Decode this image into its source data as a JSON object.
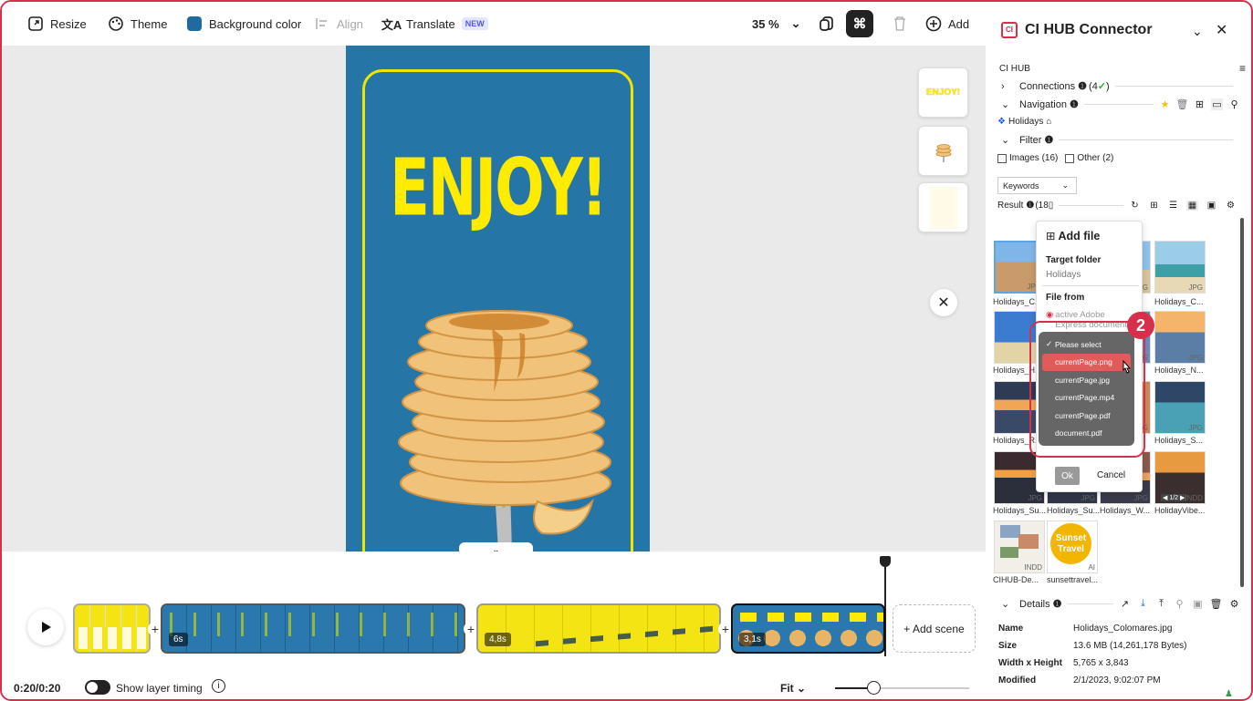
{
  "toolbar": {
    "resize": "Resize",
    "theme": "Theme",
    "background_color": "Background color",
    "background_swatch": "#1f6aa0",
    "align": "Align",
    "translate": "Translate",
    "translate_badge": "NEW",
    "zoom": "35 %",
    "add": "Add"
  },
  "canvas": {
    "poster_title": "ENJOY!",
    "thumb_label": "ENJOY!"
  },
  "timeline": {
    "scenes": [
      {
        "duration": ""
      },
      {
        "duration": "6s"
      },
      {
        "duration": "4,8s"
      },
      {
        "duration": "3,1s"
      }
    ],
    "add_scene": "+ Add scene",
    "time": "0:20/0:20",
    "show_layer_timing": "Show layer timing",
    "fit": "Fit"
  },
  "panel": {
    "title": "CI HUB Connector",
    "section": "CI HUB",
    "connections": "Connections",
    "connections_count": "(4",
    "navigation": "Navigation",
    "breadcrumb": "Holidays",
    "filter": "Filter",
    "filter_images": "Images (16)",
    "filter_other": "Other (2)",
    "keywords": "Keywords",
    "result": "Result",
    "result_count": "(18",
    "grid": [
      {
        "label": "Holidays_C...",
        "ext": "JPG"
      },
      {
        "label": "",
        "ext": "JPG"
      },
      {
        "label": "Holidays_C...",
        "ext": "JPG"
      },
      {
        "label": "Holidays_H...",
        "ext": ""
      },
      {
        "label": "",
        "ext": "JPG"
      },
      {
        "label": "Holidays_N...",
        "ext": "JPG"
      },
      {
        "label": "Holidays_R...",
        "ext": ""
      },
      {
        "label": "",
        "ext": "JPG"
      },
      {
        "label": "Holidays_S...",
        "ext": "JPG"
      },
      {
        "label": "Holidays_Su...",
        "ext": "JPG"
      },
      {
        "label": "Holidays_Su...",
        "ext": "JPG"
      },
      {
        "label": "Holidays_W...",
        "ext": "JPG"
      },
      {
        "label": "HolidayVibe...",
        "ext": "INDD",
        "pager": "1/2"
      },
      {
        "label": "CIHUB-De...",
        "ext": "INDD"
      },
      {
        "label": "sunsettravel...",
        "ext": "AI",
        "logo": "Sunset Travel"
      }
    ],
    "details": {
      "title": "Details",
      "name_label": "Name",
      "name": "Holidays_Colomares.jpg",
      "size_label": "Size",
      "size": "13.6 MB (14,261,178 Bytes)",
      "wh_label": "Width x Height",
      "wh": "5,765 x 3,843",
      "modified_label": "Modified",
      "modified": "2/1/2023, 9:02:07 PM"
    }
  },
  "addfile": {
    "title": "Add file",
    "target_folder_label": "Target folder",
    "target_folder": "Holidays",
    "file_from_label": "File from",
    "file_from_option": "active Adobe Express document",
    "ok": "Ok",
    "cancel": "Cancel",
    "dropdown": [
      "Please select",
      "currentPage.png",
      "currentPage.jpg",
      "currentPage.mp4",
      "currentPage.pdf",
      "document.pdf"
    ],
    "selected_index": 1,
    "step_number": "2"
  },
  "colors": {
    "accent": "#d6304a",
    "poster_bg": "#2576a6",
    "poster_text": "#ffeb00"
  }
}
